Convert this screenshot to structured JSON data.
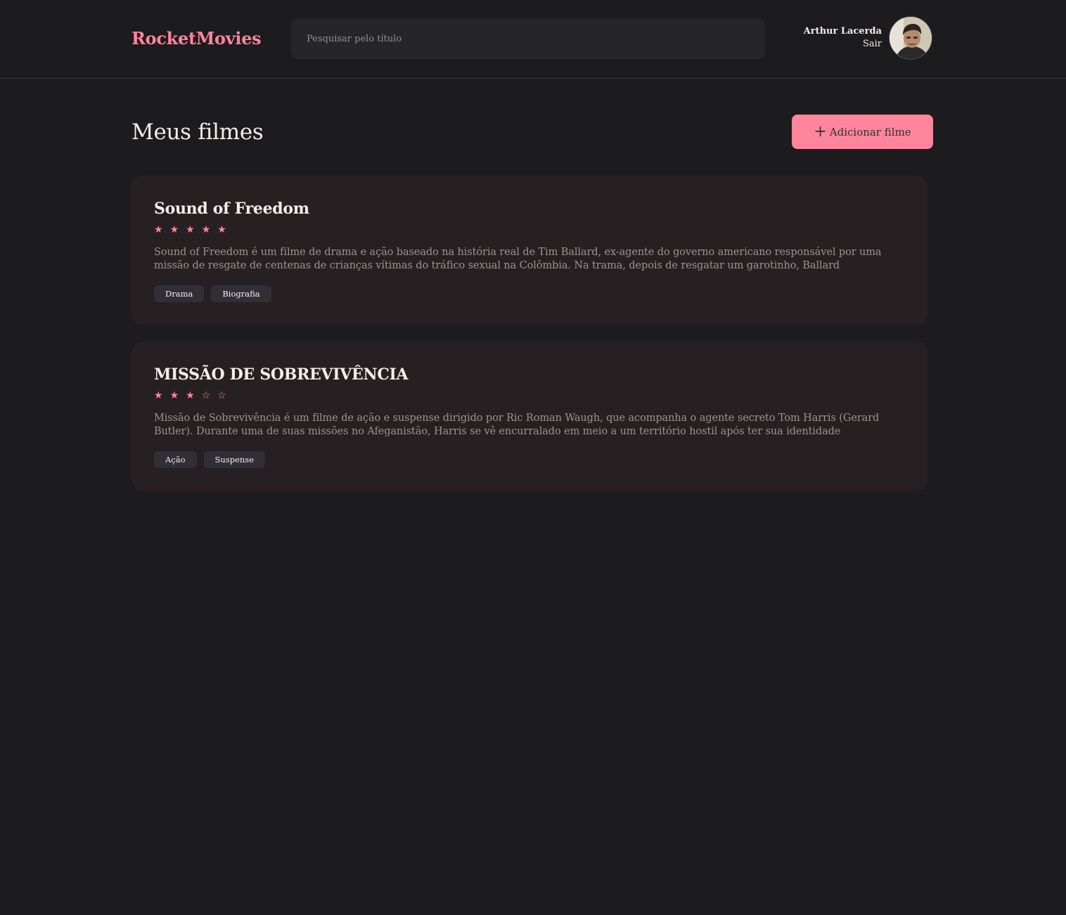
{
  "header": {
    "brand": "RocketMovies",
    "search_placeholder": "Pesquisar pelo título",
    "user_name": "Arthur Lacerda",
    "signout_label": "Sair"
  },
  "main": {
    "title": "Meus filmes",
    "add_button_label": "Adicionar filme"
  },
  "movies": [
    {
      "title": "Sound of Freedom",
      "rating": 5,
      "description": "Sound of Freedom é um filme de drama e ação baseado na história real de Tim Ballard, ex-agente do governo americano responsável por uma missão de resgate de centenas de crianças vítimas do tráfico sexual na Colômbia. Na trama, depois de resgatar um garotinho, Ballard",
      "tags": [
        "Drama",
        "Biografia"
      ]
    },
    {
      "title": "MISSÃO DE SOBREVIVÊNCIA",
      "rating": 3,
      "description": "Missão de Sobrevivência é um filme de ação e suspense dirigido por Ric Roman Waugh, que acompanha o agente secreto Tom Harris (Gerard Butler). Durante uma de suas missões no Afeganistão, Harris se vê encurralado em meio a um território hostil após ter sua identidade",
      "tags": [
        "Ação",
        "Suspense"
      ]
    }
  ],
  "colors": {
    "background": "#1c1b1e",
    "accent": "#ff859b",
    "card": "#262022",
    "tag": "#312e38",
    "text": "#f4ede8",
    "muted": "#999591"
  },
  "icons": {
    "add": "plus-icon",
    "star_filled": "star-filled-icon",
    "star_empty": "star-outline-icon"
  }
}
